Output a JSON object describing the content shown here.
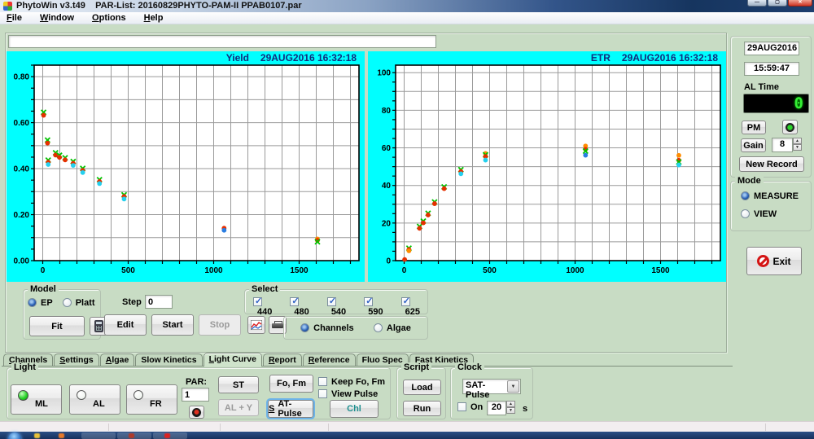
{
  "window": {
    "app_title": "PhytoWin v3.t49",
    "doc_title": "PAR-List: 20160829PHYTO-PAM-II PPAB0107.par",
    "controls": {
      "minimize": "—",
      "maximize": "▢",
      "close": "✕"
    }
  },
  "menu": {
    "items": [
      {
        "label": "File",
        "u": 0
      },
      {
        "label": "Window",
        "u": 0
      },
      {
        "label": "Options",
        "u": 0
      },
      {
        "label": "Help",
        "u": 0
      }
    ]
  },
  "top_field": {
    "value": ""
  },
  "channel_colors": {
    "440": "#2a7de1",
    "480": "#25d0ee",
    "540": "#00c400",
    "590": "#ff8c00",
    "625": "#e62f00"
  },
  "chart_data": [
    {
      "type": "scatter",
      "title": "Yield",
      "timestamp": "29AUG2016  16:32:18",
      "xlabel": "",
      "ylabel": "",
      "xlim": [
        -50,
        1850
      ],
      "ylim": [
        0,
        0.85
      ],
      "grid": true,
      "x_grid_step": 100,
      "y_grid_step": 0.1,
      "y_minor_step": 0.05,
      "x_tick_labels": [
        0,
        500,
        1000,
        1500
      ],
      "y_tick_labels": [
        0.0,
        0.2,
        0.4,
        0.6,
        0.8
      ],
      "y_label_decimals": 2,
      "series_note": "channel keys are wavelengths nm; 540 drawn as X marker",
      "clusters": [
        {
          "x": 5,
          "points": [
            [
              "540",
              0.645
            ],
            [
              "625",
              0.632
            ]
          ]
        },
        {
          "x": 28,
          "points": [
            [
              "540",
              0.524
            ],
            [
              "625",
              0.511
            ]
          ]
        },
        {
          "x": 32,
          "points": [
            [
              "540",
              0.437
            ],
            [
              "625",
              0.428
            ],
            [
              "480",
              0.418
            ]
          ]
        },
        {
          "x": 75,
          "points": [
            [
              "540",
              0.469
            ],
            [
              "625",
              0.459
            ]
          ]
        },
        {
          "x": 98,
          "points": [
            [
              "540",
              0.458
            ],
            [
              "625",
              0.449
            ]
          ]
        },
        {
          "x": 131,
          "points": [
            [
              "540",
              0.447
            ],
            [
              "625",
              0.438
            ]
          ]
        },
        {
          "x": 178,
          "points": [
            [
              "540",
              0.431
            ],
            [
              "625",
              0.423
            ],
            [
              "480",
              0.414
            ]
          ]
        },
        {
          "x": 234,
          "points": [
            [
              "540",
              0.401
            ],
            [
              "625",
              0.392
            ],
            [
              "480",
              0.383
            ]
          ]
        },
        {
          "x": 332,
          "points": [
            [
              "540",
              0.352
            ],
            [
              "625",
              0.344
            ],
            [
              "480",
              0.335
            ]
          ]
        },
        {
          "x": 476,
          "points": [
            [
              "540",
              0.286
            ],
            [
              "625",
              0.279
            ],
            [
              "480",
              0.268
            ]
          ]
        },
        {
          "x": 1061,
          "points": [
            [
              "625",
              0.141
            ],
            [
              "440",
              0.132
            ]
          ]
        },
        {
          "x": 1607,
          "points": [
            [
              "590",
              0.094
            ],
            [
              "625",
              0.088
            ],
            [
              "540",
              0.082
            ]
          ]
        }
      ]
    },
    {
      "type": "scatter",
      "title": "ETR",
      "timestamp": "29AUG2016  16:32:18",
      "xlabel": "",
      "ylabel": "",
      "xlim": [
        -50,
        1850
      ],
      "ylim": [
        0,
        104
      ],
      "grid": true,
      "x_grid_step": 100,
      "y_grid_step": 10,
      "y_minor_step": 5,
      "x_tick_labels": [
        0,
        500,
        1000,
        1500
      ],
      "y_tick_labels": [
        0,
        20,
        40,
        60,
        80,
        100
      ],
      "y_label_decimals": 0,
      "clusters": [
        {
          "x": 3,
          "points": [
            [
              "625",
              0.6
            ]
          ]
        },
        {
          "x": 28,
          "points": [
            [
              "540",
              6.6
            ],
            [
              "625",
              5.9
            ],
            [
              "590",
              5.2
            ]
          ]
        },
        {
          "x": 90,
          "points": [
            [
              "540",
              18.2
            ],
            [
              "625",
              17.2
            ]
          ]
        },
        {
          "x": 112,
          "points": [
            [
              "540",
              21.0
            ],
            [
              "625",
              20.1
            ]
          ]
        },
        {
          "x": 140,
          "points": [
            [
              "540",
              25.2
            ],
            [
              "625",
              24.3
            ]
          ]
        },
        {
          "x": 178,
          "points": [
            [
              "540",
              31.2
            ],
            [
              "625",
              30.3
            ]
          ]
        },
        {
          "x": 234,
          "points": [
            [
              "540",
              39.2
            ],
            [
              "625",
              38.3
            ]
          ]
        },
        {
          "x": 332,
          "points": [
            [
              "540",
              48.4
            ],
            [
              "625",
              47.4
            ],
            [
              "480",
              46.2
            ]
          ]
        },
        {
          "x": 476,
          "points": [
            [
              "590",
              57.0
            ],
            [
              "540",
              56.3
            ],
            [
              "625",
              55.4
            ],
            [
              "480",
              53.5
            ]
          ]
        },
        {
          "x": 1061,
          "points": [
            [
              "590",
              61.0
            ],
            [
              "625",
              59.2
            ],
            [
              "540",
              58.3
            ],
            [
              "440",
              56.1
            ]
          ]
        },
        {
          "x": 1607,
          "points": [
            [
              "590",
              56.0
            ],
            [
              "625",
              53.4
            ],
            [
              "540",
              52.5
            ],
            [
              "480",
              50.9
            ]
          ]
        }
      ]
    }
  ],
  "right_panel": {
    "date": "29AUG2016",
    "time": "15:59:47",
    "al_time_label": "AL Time",
    "al_time_value": "0",
    "pm_label": "PM",
    "gain_label": "Gain",
    "gain_value": "8",
    "new_record_label": "New Record",
    "mode": {
      "label": "Mode",
      "options": [
        {
          "label": "MEASURE",
          "selected": true
        },
        {
          "label": "VIEW",
          "selected": false
        }
      ]
    },
    "exit_label": "Exit"
  },
  "controls": {
    "model": {
      "label": "Model",
      "options": [
        {
          "label": "EP",
          "selected": true
        },
        {
          "label": "Platt",
          "selected": false
        }
      ],
      "fit_label": "Fit"
    },
    "step_label": "Step",
    "step_value": "0",
    "edit_label": "Edit",
    "start_label": "Start",
    "stop_label": "Stop",
    "select": {
      "label": "Select",
      "options": [
        {
          "label": "440",
          "checked": true
        },
        {
          "label": "480",
          "checked": true
        },
        {
          "label": "540",
          "checked": true
        },
        {
          "label": "590",
          "checked": true
        },
        {
          "label": "625",
          "checked": true
        }
      ]
    },
    "view_mode": {
      "options": [
        {
          "label": "Channels",
          "selected": true
        },
        {
          "label": "Algae",
          "selected": false
        }
      ]
    }
  },
  "tabs": {
    "items": [
      {
        "label": "Channels",
        "u": 0,
        "active": false
      },
      {
        "label": "Settings",
        "u": 0,
        "active": false
      },
      {
        "label": "Algae",
        "u": 0,
        "active": false
      },
      {
        "label": "Slow Kinetics",
        "u": -1,
        "active": false
      },
      {
        "label": "Light Curve",
        "u": 0,
        "active": true
      },
      {
        "label": "Report",
        "u": 0,
        "active": false
      },
      {
        "label": "Reference",
        "u": 0,
        "active": false
      },
      {
        "label": "Fluo Spec",
        "u": -1,
        "active": false
      },
      {
        "label": "Fast Kinetics",
        "u": -1,
        "active": false
      }
    ]
  },
  "light": {
    "label": "Light",
    "buttons": [
      {
        "label": "ML",
        "led": "on"
      },
      {
        "label": "AL",
        "led": "off"
      },
      {
        "label": "FR",
        "led": "off"
      }
    ],
    "par_label": "PAR:",
    "par_value": "1",
    "st_label": "ST",
    "aly_label": "AL + Y",
    "fofm_label": "Fo, Fm",
    "satpulse_label": "SAT-Pulse",
    "satpulse_u": 0,
    "chl_label": "Chl",
    "chl_color": "#1f8f8f",
    "checkboxes": [
      {
        "label": "Keep Fo, Fm",
        "checked": false
      },
      {
        "label": "View Pulse",
        "checked": false
      }
    ]
  },
  "script_group": {
    "label": "Script",
    "load_label": "Load",
    "run_label": "Run"
  },
  "clock_group": {
    "label": "Clock",
    "mode_value": "SAT-Pulse",
    "on_label": "On",
    "on_checked": false,
    "interval_value": "20",
    "unit_label": "s"
  }
}
